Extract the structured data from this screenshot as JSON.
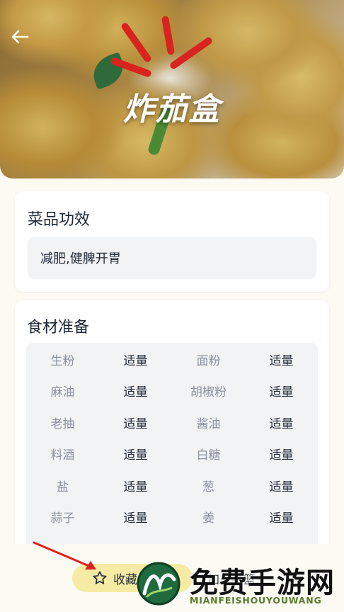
{
  "header": {
    "title": "炸茄盒"
  },
  "effect": {
    "title": "菜品功效",
    "text": "减肥,健脾开胃"
  },
  "ingredients": {
    "title": "食材准备",
    "rows": [
      [
        {
          "name": "生粉",
          "qty": "适量"
        },
        {
          "name": "面粉",
          "qty": "适量"
        }
      ],
      [
        {
          "name": "麻油",
          "qty": "适量"
        },
        {
          "name": "胡椒粉",
          "qty": "适量"
        }
      ],
      [
        {
          "name": "老抽",
          "qty": "适量"
        },
        {
          "name": "酱油",
          "qty": "适量"
        }
      ],
      [
        {
          "name": "料酒",
          "qty": "适量"
        },
        {
          "name": "白糖",
          "qty": "适量"
        }
      ],
      [
        {
          "name": "盐",
          "qty": "适量"
        },
        {
          "name": "葱",
          "qty": "适量"
        }
      ],
      [
        {
          "name": "蒜子",
          "qty": "适量"
        },
        {
          "name": "姜",
          "qty": "适量"
        }
      ]
    ]
  },
  "actions": {
    "favorite_label": "收藏",
    "basket_label": "加入菜篮"
  },
  "watermark": {
    "title": "免费手游网",
    "subtitle": "MIANFEISHOUYOUWANG"
  },
  "colors": {
    "background": "#fbfaf3",
    "favorite_bg": "#f6eba4",
    "arrow": "#e02020"
  }
}
